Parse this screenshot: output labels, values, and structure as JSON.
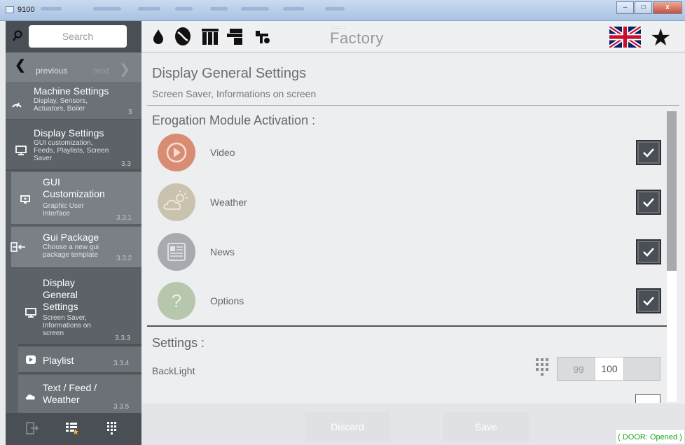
{
  "window": {
    "title": "9100"
  },
  "sidebar": {
    "search_placeholder": "Search",
    "nav": {
      "previous": "previous",
      "next": "next"
    },
    "items": [
      {
        "title": "Machine Settings",
        "subtitle": "Display, Sensors,",
        "subtitle2": "Actuators, Boiler",
        "number": "3",
        "icon": "gauge-icon"
      },
      {
        "title": "Display Settings",
        "subtitle": "GUI customization,",
        "subtitle2": "Feeds, Playlists, Screen",
        "subtitle3": "Saver",
        "number": "3.3",
        "icon": "monitor-icon"
      },
      {
        "title": "GUI",
        "title2": "Customization",
        "subtitle": "Graphic User",
        "subtitle2": "Interface",
        "number": "3.3.1",
        "icon": "screen-icon"
      },
      {
        "title": "Gui Package",
        "subtitle": "Choose a new gui",
        "subtitle2": "package template",
        "number": "3.3.2",
        "icon": "package-import-icon"
      },
      {
        "title": "Display",
        "title2": "General",
        "title3": "Settings",
        "subtitle": "Screen Saver,",
        "subtitle2": "Informations on",
        "subtitle3": "screen",
        "number": "3.3.3",
        "icon": "monitor-icon"
      },
      {
        "title": "Playlist",
        "number": "3.3.4",
        "icon": "play-icon"
      },
      {
        "title": "Text / Feed /",
        "title2": "Weather",
        "number": "3.3.5",
        "icon": "cloud-icon"
      }
    ]
  },
  "header": {
    "icons": [
      "water-drop-icon",
      "coffee-bean-icon",
      "grinder-icon",
      "brew-group-icon",
      "tools-icon"
    ],
    "mode": "Factory",
    "language": "uk-flag-icon",
    "favorite": "star-icon"
  },
  "page": {
    "title": "Display General Settings",
    "subtitle": "Screen Saver, Informations on screen",
    "section_modules": "Erogation Module Activation :",
    "modules": [
      {
        "label": "Video",
        "checked": true,
        "icon": "video-play-icon",
        "color": "#d98c74"
      },
      {
        "label": "Weather",
        "checked": true,
        "icon": "weather-icon",
        "color": "#c9c2ae"
      },
      {
        "label": "News",
        "checked": true,
        "icon": "news-icon",
        "color": "#a7aaaf"
      },
      {
        "label": "Options",
        "checked": true,
        "icon": "question-icon",
        "color": "#b6c7ae"
      }
    ],
    "section_settings": "Settings :",
    "backlight": {
      "label": "BackLight",
      "previous_value": "99",
      "value": "100"
    }
  },
  "footer": {
    "discard": "Discard",
    "save": "Save",
    "door_status": "( DOOR: Opened )"
  }
}
